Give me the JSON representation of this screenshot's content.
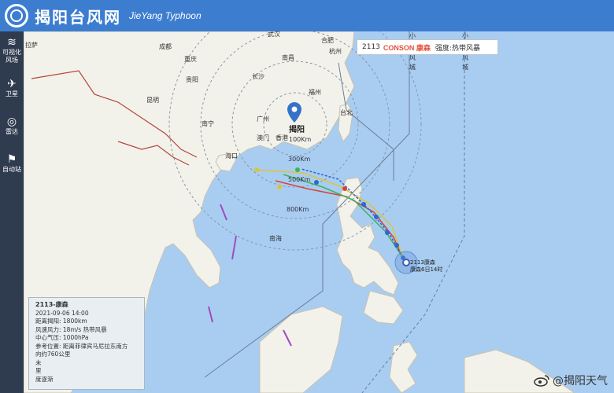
{
  "header": {
    "title": "揭阳台风网",
    "subtitle": "JieYang Typhoon"
  },
  "sidebar": {
    "items": [
      {
        "icon": "wind-icon",
        "label": "可视化风场"
      },
      {
        "icon": "satellite-icon",
        "label": "卫星"
      },
      {
        "icon": "radar-icon",
        "label": "雷达"
      },
      {
        "icon": "flag-icon",
        "label": "自动站"
      }
    ]
  },
  "map": {
    "cities": {
      "yuxi": "拉萨",
      "chengdu": "成都",
      "wuhan": "武汉",
      "hefei": "合肥",
      "hangzhou": "杭州",
      "chongqing": "重庆",
      "nanchang": "南昌",
      "guiyang": "贵阳",
      "changsha": "长沙",
      "fuzhou": "福州",
      "kunming": "昆明",
      "nanning": "南宁",
      "guangzhou": "广州",
      "aomen": "澳门",
      "xianggang": "香港",
      "taibei": "台北",
      "haikou": "海口",
      "sea": "南海"
    },
    "pin_label": "揭阳",
    "rings": [
      "100Km",
      "300Km",
      "500Km",
      "800Km"
    ],
    "line_labels": [
      "小",
      "风",
      "城",
      "小",
      "风",
      "城"
    ]
  },
  "popup": {
    "code": "2113",
    "name": "CONSON 康森",
    "intensity": "强度:热带风暴"
  },
  "storm_label": {
    "line1": "2113康森",
    "line2": "康森6日14时"
  },
  "info": {
    "title": "2113-康森",
    "time": "2021-09-06 14:00",
    "distance": "距离揭阳: 1800km",
    "wind": "风速风力: 18m/s 热带风暴",
    "pressure": "中心气压: 1000hPa",
    "reference": "参考位置: 距离菲律宾马尼拉东南方",
    "reference2": "向约760公里",
    "future": "未",
    "row7": "里",
    "row8": "度逐渐"
  },
  "watermark": "@揭阳天气",
  "colors": {
    "header": "#3d7dd0",
    "sidebar": "#2f3b4f",
    "sea": "#a9cdf0",
    "land": "#f3f2ea",
    "track": "#2a67d8",
    "forecast_red": "#d9413a",
    "forecast_green": "#3db35a",
    "forecast_yellow": "#d8c63a",
    "warning_line": "#e0b14a"
  }
}
